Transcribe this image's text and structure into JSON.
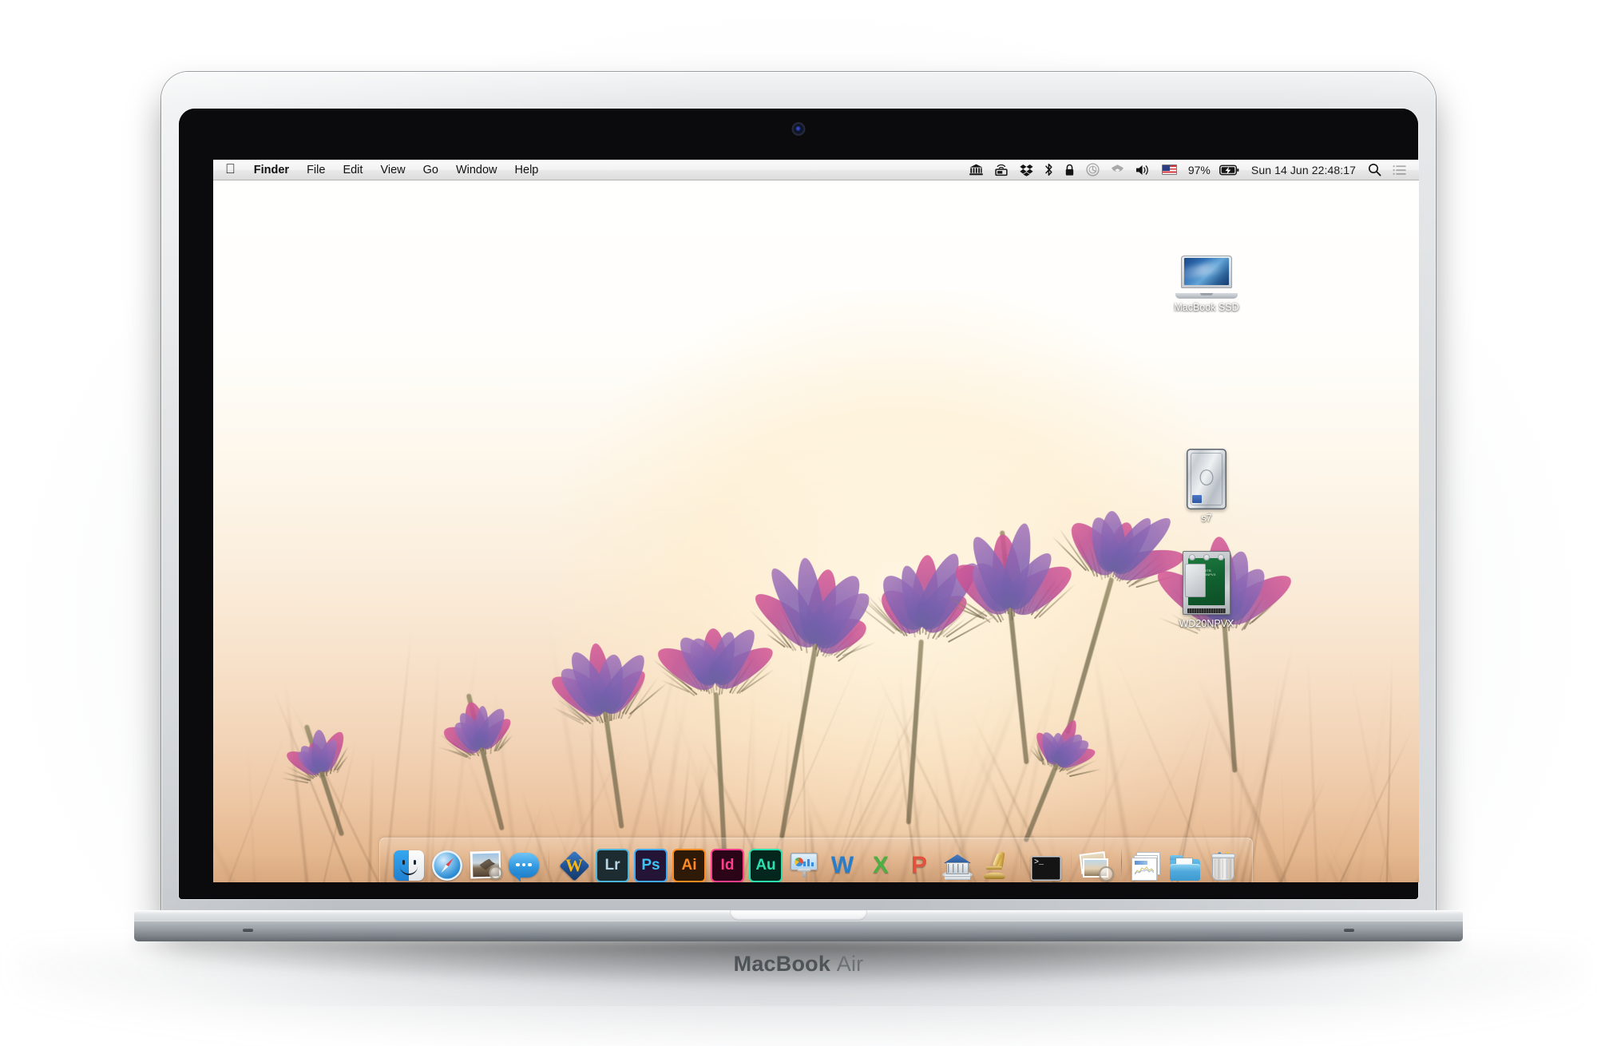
{
  "device": {
    "brand_bold": "MacBook",
    "brand_light": "Air"
  },
  "menubar": {
    "apple_logo": "apple-icon",
    "items": [
      {
        "label": "Finder",
        "active": true
      },
      {
        "label": "File",
        "active": false
      },
      {
        "label": "Edit",
        "active": false
      },
      {
        "label": "View",
        "active": false
      },
      {
        "label": "Go",
        "active": false
      },
      {
        "label": "Window",
        "active": false
      },
      {
        "label": "Help",
        "active": false
      }
    ],
    "status": {
      "bank_icon": "bank-building-icon",
      "screen_sharing_icon": "screen-sharing-icon",
      "dropbox_icon": "dropbox-icon",
      "bluetooth_icon": "bluetooth-icon",
      "lock_icon": "lock-icon",
      "timemachine_icon": "time-machine-icon",
      "wifi_icon": "wifi-icon",
      "volume_icon": "volume-icon",
      "flag_icon": "us-flag-icon",
      "battery_percent": "97%",
      "battery_icon": "battery-charging-icon",
      "datetime": "Sun 14 Jun  22:48:17",
      "spotlight_icon": "search-icon",
      "notification_center_icon": "notification-center-icon"
    }
  },
  "desktop": {
    "icons": [
      {
        "label": "MacBook SSD",
        "kind": "internal-drive"
      },
      {
        "label": "s7",
        "kind": "external-drive"
      },
      {
        "label": "WD20NPVX",
        "kind": "bare-drive"
      }
    ],
    "wallpaper_name": "pasque-flowers-sunset"
  },
  "dock": {
    "items": [
      {
        "name": "finder",
        "label": "Finder",
        "running": true
      },
      {
        "name": "safari",
        "label": "Safari",
        "running": false
      },
      {
        "name": "mail",
        "label": "Mail",
        "running": false
      },
      {
        "name": "messages",
        "label": "Messages",
        "running": false
      },
      {
        "name": "mathematica",
        "label": "Mathematica",
        "running": false,
        "glyph": "W"
      },
      {
        "name": "lightroom",
        "label": "Adobe Lightroom",
        "running": false,
        "glyph": "Lr",
        "fg": "#b6d6e6",
        "bg": "#1c2c31",
        "border": "#4cb3d9"
      },
      {
        "name": "photoshop",
        "label": "Adobe Photoshop",
        "running": false,
        "glyph": "Ps",
        "fg": "#3fc3f5",
        "bg": "#241537",
        "border": "#3fa9f5"
      },
      {
        "name": "illustrator",
        "label": "Adobe Illustrator",
        "running": false,
        "glyph": "Ai",
        "fg": "#ff8a22",
        "bg": "#2e1a06",
        "border": "#ff8a22"
      },
      {
        "name": "indesign",
        "label": "Adobe InDesign",
        "running": false,
        "glyph": "Id",
        "fg": "#ff3d8b",
        "bg": "#2b0418",
        "border": "#ff3d8b"
      },
      {
        "name": "audition",
        "label": "Adobe Audition",
        "running": false,
        "glyph": "Au",
        "fg": "#2ce0b0",
        "bg": "#03261d",
        "border": "#2ce0b0"
      },
      {
        "name": "keynote",
        "label": "Keynote",
        "running": false
      },
      {
        "name": "word",
        "label": "Microsoft Word",
        "running": false,
        "glyph": "W",
        "color": "#2a7cc7"
      },
      {
        "name": "excel",
        "label": "Microsoft Excel",
        "running": false,
        "glyph": "X",
        "color": "#4caf40"
      },
      {
        "name": "powerpoint",
        "label": "Microsoft PowerPoint",
        "running": false,
        "glyph": "P",
        "color": "#e0523c"
      },
      {
        "name": "bank",
        "label": "Bank",
        "running": false
      },
      {
        "name": "microscope",
        "label": "Microscope",
        "running": false
      },
      {
        "name": "terminal",
        "label": "Terminal",
        "running": false,
        "glyph": ">_"
      },
      {
        "name": "preview",
        "label": "Preview",
        "running": true
      }
    ],
    "stack_items": [
      {
        "name": "documents-stack",
        "label": "Documents"
      },
      {
        "name": "downloads-folder",
        "label": "Downloads",
        "minimized_bar": true
      },
      {
        "name": "trash",
        "label": "Trash"
      }
    ]
  }
}
